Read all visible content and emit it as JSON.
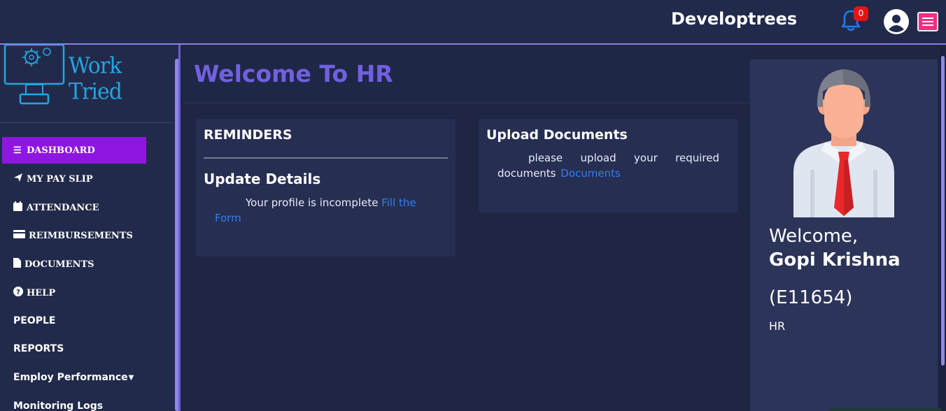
{
  "header": {
    "brand": "Developtrees",
    "notifications_count": "0",
    "icons": [
      "bell-icon",
      "user-circle-icon",
      "hamburger-menu-icon"
    ],
    "accent_color": "#ee2f86"
  },
  "sidebar": {
    "logo_text": "Work Tried",
    "items": [
      {
        "label": "DASHBOARD",
        "icon": "bars-icon",
        "active": true
      },
      {
        "label": "MY PAY SLIP",
        "icon": "paper-plane-icon"
      },
      {
        "label": "ATTENDANCE",
        "icon": "calendar-icon"
      },
      {
        "label": "REIMBURSEMENTS",
        "icon": "credit-card-icon"
      },
      {
        "label": "DOCUMENTS",
        "icon": "file-icon"
      },
      {
        "label": "HELP",
        "icon": "question-circle-icon"
      },
      {
        "label": "PEOPLE"
      },
      {
        "label": "REPORTS"
      },
      {
        "label": "Employ Performance",
        "icon": "caret-down-icon"
      },
      {
        "label": "Monitoring Logs"
      }
    ],
    "active_color": "#8e16e0"
  },
  "main": {
    "title": "Welcome To HR",
    "reminders": {
      "title": "REMINDERS",
      "subtitle": "Update Details",
      "text": "Your profile is incomplete",
      "link": "Fill the Form"
    },
    "upload": {
      "title": "Upload Documents",
      "text": "please upload your required documents",
      "link": "Documents"
    }
  },
  "profile": {
    "welcome": "Welcome,",
    "name": "Gopi Krishna",
    "emp_id": "(E11654)",
    "department": "HR"
  }
}
